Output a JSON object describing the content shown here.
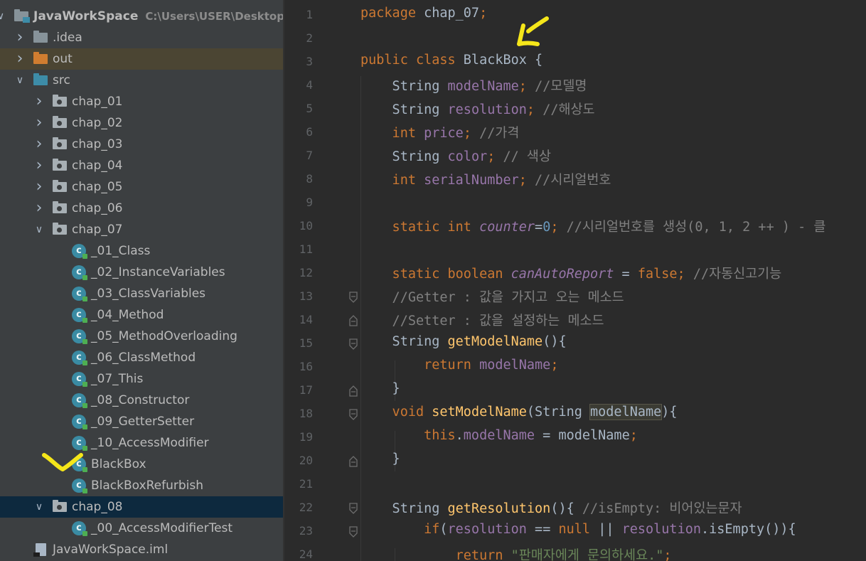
{
  "project": {
    "root_name": "JavaWorkSpace",
    "root_path": "C:\\Users\\USER\\Desktop",
    "items": [
      {
        "label": "JavaWorkSpace"
      },
      {
        "label": ".idea"
      },
      {
        "label": "out"
      },
      {
        "label": "src"
      },
      {
        "label": "chap_01"
      },
      {
        "label": "chap_02"
      },
      {
        "label": "chap_03"
      },
      {
        "label": "chap_04"
      },
      {
        "label": "chap_05"
      },
      {
        "label": "chap_06"
      },
      {
        "label": "chap_07"
      },
      {
        "label": "_01_Class"
      },
      {
        "label": "_02_InstanceVariables"
      },
      {
        "label": "_03_ClassVariables"
      },
      {
        "label": "_04_Method"
      },
      {
        "label": "_05_MethodOverloading"
      },
      {
        "label": "_06_ClassMethod"
      },
      {
        "label": "_07_This"
      },
      {
        "label": "_08_Constructor"
      },
      {
        "label": "_09_GetterSetter"
      },
      {
        "label": "_10_AccessModifier"
      },
      {
        "label": "BlackBox"
      },
      {
        "label": "BlackBoxRefurbish"
      },
      {
        "label": "chap_08"
      },
      {
        "label": "_00_AccessModifierTest"
      },
      {
        "label": "JavaWorkSpace.iml"
      }
    ]
  },
  "editor": {
    "line_numbers": [
      "1",
      "2",
      "3",
      "4",
      "5",
      "6",
      "7",
      "8",
      "9",
      "10",
      "11",
      "12",
      "13",
      "14",
      "15",
      "16",
      "17",
      "18",
      "19",
      "20",
      "21",
      "22",
      "23",
      "24"
    ],
    "lines": [
      {
        "t": [
          [
            "kw",
            "package "
          ],
          [
            "",
            "chap_07"
          ],
          [
            "kw",
            ";"
          ]
        ]
      },
      {
        "t": []
      },
      {
        "t": [
          [
            "kw",
            "public class "
          ],
          [
            "",
            "BlackBox {"
          ]
        ]
      },
      {
        "t": [
          [
            "",
            "    String "
          ],
          [
            "fld",
            "modelName"
          ],
          [
            "kw",
            "; "
          ],
          [
            "cmt",
            "//모델명"
          ]
        ]
      },
      {
        "t": [
          [
            "",
            "    String "
          ],
          [
            "fld",
            "resolution"
          ],
          [
            "kw",
            "; "
          ],
          [
            "cmt",
            "//해상도"
          ]
        ]
      },
      {
        "t": [
          [
            "kw",
            "    int "
          ],
          [
            "fld",
            "price"
          ],
          [
            "kw",
            "; "
          ],
          [
            "cmt",
            "//가격"
          ]
        ]
      },
      {
        "t": [
          [
            "",
            "    String "
          ],
          [
            "fld",
            "color"
          ],
          [
            "kw",
            "; "
          ],
          [
            "cmt",
            "// 색상"
          ]
        ]
      },
      {
        "t": [
          [
            "kw",
            "    int "
          ],
          [
            "fld",
            "serialNumber"
          ],
          [
            "kw",
            "; "
          ],
          [
            "cmt",
            "//시리얼번호"
          ]
        ]
      },
      {
        "t": []
      },
      {
        "t": [
          [
            "kw",
            "    static int "
          ],
          [
            "sfld",
            "counter"
          ],
          [
            "",
            "="
          ],
          [
            "num",
            "0"
          ],
          [
            "kw",
            "; "
          ],
          [
            "cmt",
            "//시리얼번호를 생성(0, 1, 2 ++ ) - 클"
          ]
        ]
      },
      {
        "t": []
      },
      {
        "t": [
          [
            "kw",
            "    static boolean "
          ],
          [
            "sfld",
            "canAutoReport"
          ],
          [
            "",
            " = "
          ],
          [
            "kw",
            "false; "
          ],
          [
            "cmt",
            "//자동신고기능"
          ]
        ]
      },
      {
        "t": [
          [
            "cmt",
            "    //Getter : 값을 가지고 오는 메소드"
          ]
        ]
      },
      {
        "t": [
          [
            "cmt",
            "    //Setter : 값을 설정하는 메소드"
          ]
        ]
      },
      {
        "t": [
          [
            "",
            "    String "
          ],
          [
            "mth",
            "getModelName"
          ],
          [
            "",
            "(){"
          ]
        ]
      },
      {
        "t": [
          [
            "kw",
            "        return "
          ],
          [
            "fld",
            "modelName"
          ],
          [
            "kw",
            ";"
          ]
        ]
      },
      {
        "t": [
          [
            "",
            "    }"
          ]
        ]
      },
      {
        "t": [
          [
            "kw",
            "    void "
          ],
          [
            "mth",
            "setModelName"
          ],
          [
            "",
            "(String "
          ],
          [
            "param-hl",
            "modelName"
          ],
          [
            "",
            "){"
          ]
        ]
      },
      {
        "t": [
          [
            "kw",
            "        this"
          ],
          [
            "",
            "."
          ],
          [
            "fld",
            "modelName"
          ],
          [
            "",
            " = modelName"
          ],
          [
            "kw",
            ";"
          ]
        ]
      },
      {
        "t": [
          [
            "",
            "    }"
          ]
        ]
      },
      {
        "t": []
      },
      {
        "t": [
          [
            "",
            "    String "
          ],
          [
            "mth",
            "getResolution"
          ],
          [
            "",
            "(){ "
          ],
          [
            "cmt",
            "//isEmpty: 비어있는문자"
          ]
        ]
      },
      {
        "t": [
          [
            "kw",
            "        if"
          ],
          [
            "",
            "("
          ],
          [
            "fld",
            "resolution"
          ],
          [
            "",
            " == "
          ],
          [
            "kw",
            "null "
          ],
          [
            "",
            "|| "
          ],
          [
            "fld",
            "resolution"
          ],
          [
            "",
            ".isEmpty()){"
          ]
        ]
      },
      {
        "t": [
          [
            "kw",
            "            return "
          ],
          [
            "str",
            "\"판매자에게 문의하세요.\""
          ],
          [
            "kw",
            ";"
          ]
        ]
      }
    ]
  },
  "colors": {
    "sidebar_bg": "#3c3f41",
    "editor_bg": "#2b2b2b",
    "selection": "#0d293e",
    "annotation": "#f5e61a"
  }
}
